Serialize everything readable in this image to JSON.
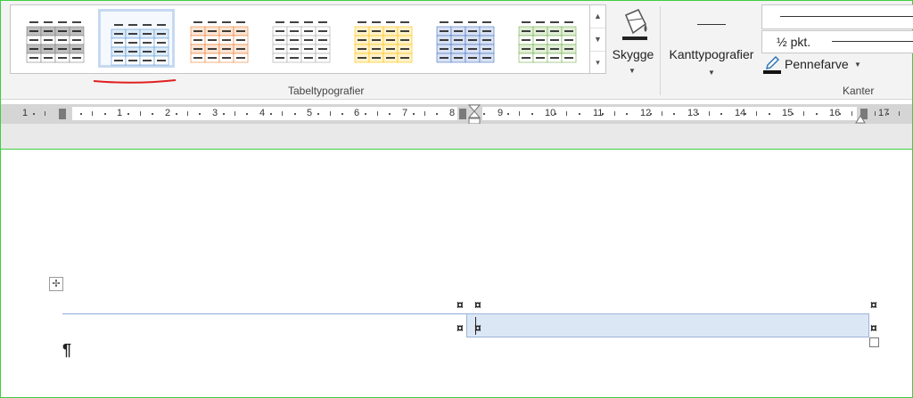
{
  "ribbon": {
    "table_styles": {
      "group_label": "Tabeltypografier",
      "styles": [
        {
          "name": "grid-table-dark",
          "accent": "#808080",
          "fill": "#bfbfbf"
        },
        {
          "name": "grid-table-light-blue",
          "accent": "#5b9bd5",
          "fill": "#deebf7",
          "selected": true
        },
        {
          "name": "grid-table-orange",
          "accent": "#ed7d31",
          "fill": "#fbe5d6"
        },
        {
          "name": "grid-table-plain",
          "accent": "#a6a6a6",
          "fill": "#ffffff"
        },
        {
          "name": "grid-table-gold",
          "accent": "#ffc000",
          "fill": "#fff2cc"
        },
        {
          "name": "grid-table-blue",
          "accent": "#4472c4",
          "fill": "#d9e2f3"
        },
        {
          "name": "grid-table-green",
          "accent": "#70ad47",
          "fill": "#e2efd9"
        }
      ]
    },
    "shading": {
      "label": "Skygge"
    },
    "borders": {
      "group_label": "Kanter",
      "border_styles_label": "Kanttypografier",
      "weight_label": "½ pkt.",
      "pen_color_label": "Pennefarve"
    }
  },
  "ruler": {
    "labels": [
      "1",
      "1",
      "2",
      "3",
      "4",
      "5",
      "6",
      "7",
      "8",
      "9",
      "10",
      "11",
      "12",
      "13",
      "14",
      "15",
      "16",
      "17"
    ]
  },
  "document": {
    "cell_marker": "¤",
    "paragraph_mark": "¶",
    "move_handle": "✢"
  },
  "colors": {
    "selection_fill": "#dce7f6",
    "annotation_underline": "#e02020",
    "frame": "#3fcf3f"
  }
}
